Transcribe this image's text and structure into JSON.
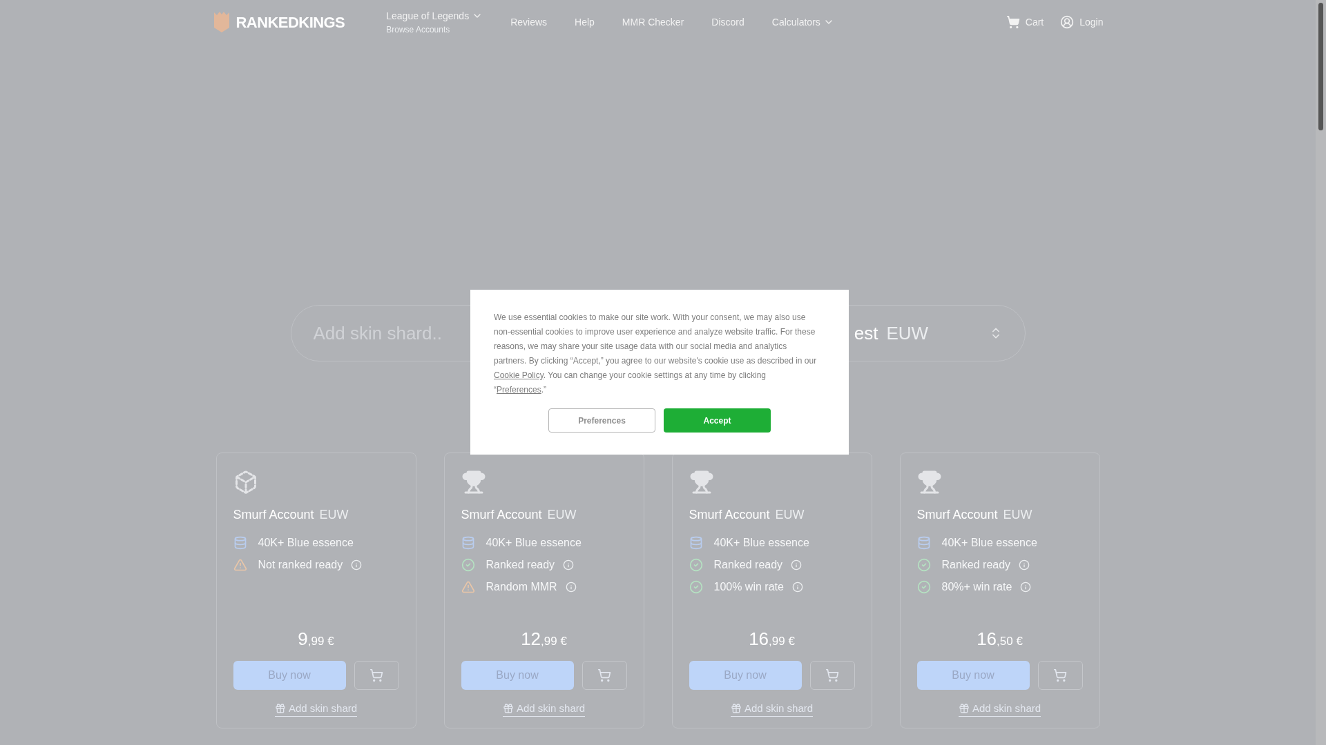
{
  "header": {
    "logo": "RANKEDKINGS",
    "nav": [
      {
        "label": "League of Legends",
        "sublabel": "Browse Accounts",
        "dropdown": true
      },
      {
        "label": "Reviews",
        "dropdown": false
      },
      {
        "label": "Help",
        "dropdown": false
      },
      {
        "label": "MMR Checker",
        "dropdown": false
      },
      {
        "label": "Discord",
        "dropdown": false
      },
      {
        "label": "Calculators",
        "dropdown": true
      }
    ],
    "cart": "Cart",
    "login": "Login"
  },
  "filter_bar": {
    "placeholder": "Add skin shard..",
    "sort_visible": "est",
    "region": "EUW"
  },
  "cards": [
    {
      "kind": "cube",
      "title": "Smurf Account",
      "region": "EUW",
      "features": [
        {
          "kind": "essence",
          "text": "40K+ Blue essence",
          "info": false
        },
        {
          "kind": "warning",
          "text": "Not ranked ready",
          "info": true
        }
      ],
      "price_whole": "9",
      "price_rest": ",99 €",
      "buy": "Buy now",
      "shard": "Add skin shard"
    },
    {
      "kind": "trophy",
      "title": "Smurf Account",
      "region": "EUW",
      "features": [
        {
          "kind": "essence",
          "text": "40K+ Blue essence",
          "info": false
        },
        {
          "kind": "check",
          "text": "Ranked ready",
          "info": true
        },
        {
          "kind": "warning",
          "text": "Random MMR",
          "info": true
        }
      ],
      "price_whole": "12",
      "price_rest": ",99 €",
      "buy": "Buy now",
      "shard": "Add skin shard"
    },
    {
      "kind": "trophy",
      "title": "Smurf Account",
      "region": "EUW",
      "features": [
        {
          "kind": "essence",
          "text": "40K+ Blue essence",
          "info": false
        },
        {
          "kind": "check",
          "text": "Ranked ready",
          "info": true
        },
        {
          "kind": "check",
          "text": "100% win rate",
          "info": true
        }
      ],
      "price_whole": "16",
      "price_rest": ",99 €",
      "buy": "Buy now",
      "shard": "Add skin shard"
    },
    {
      "kind": "trophy",
      "title": "Smurf Account",
      "region": "EUW",
      "features": [
        {
          "kind": "essence",
          "text": "40K+ Blue essence",
          "info": false
        },
        {
          "kind": "check",
          "text": "Ranked ready",
          "info": true
        },
        {
          "kind": "check",
          "text": "80%+ win rate",
          "info": true
        }
      ],
      "price_whole": "16",
      "price_rest": ",50 €",
      "buy": "Buy now",
      "shard": "Add skin shard"
    }
  ],
  "cookie_dialog": {
    "text_before": "We use essential cookies to make our site work. With your consent, we may also use non-essential cookies to improve user experience and analyze website traffic. For these reasons, we may share your site usage data with our social media and analytics partners. By clicking “Accept,” you agree to our website's cookie use as described in our ",
    "policy_link": "Cookie Policy",
    "text_middle": ". You can change your cookie settings at any time by clicking “",
    "preferences_link": "Preferences",
    "text_after": ".”",
    "buttons": [
      {
        "kind": "secondary",
        "label": "Preferences"
      },
      {
        "kind": "primary",
        "label": "Accept"
      }
    ]
  }
}
